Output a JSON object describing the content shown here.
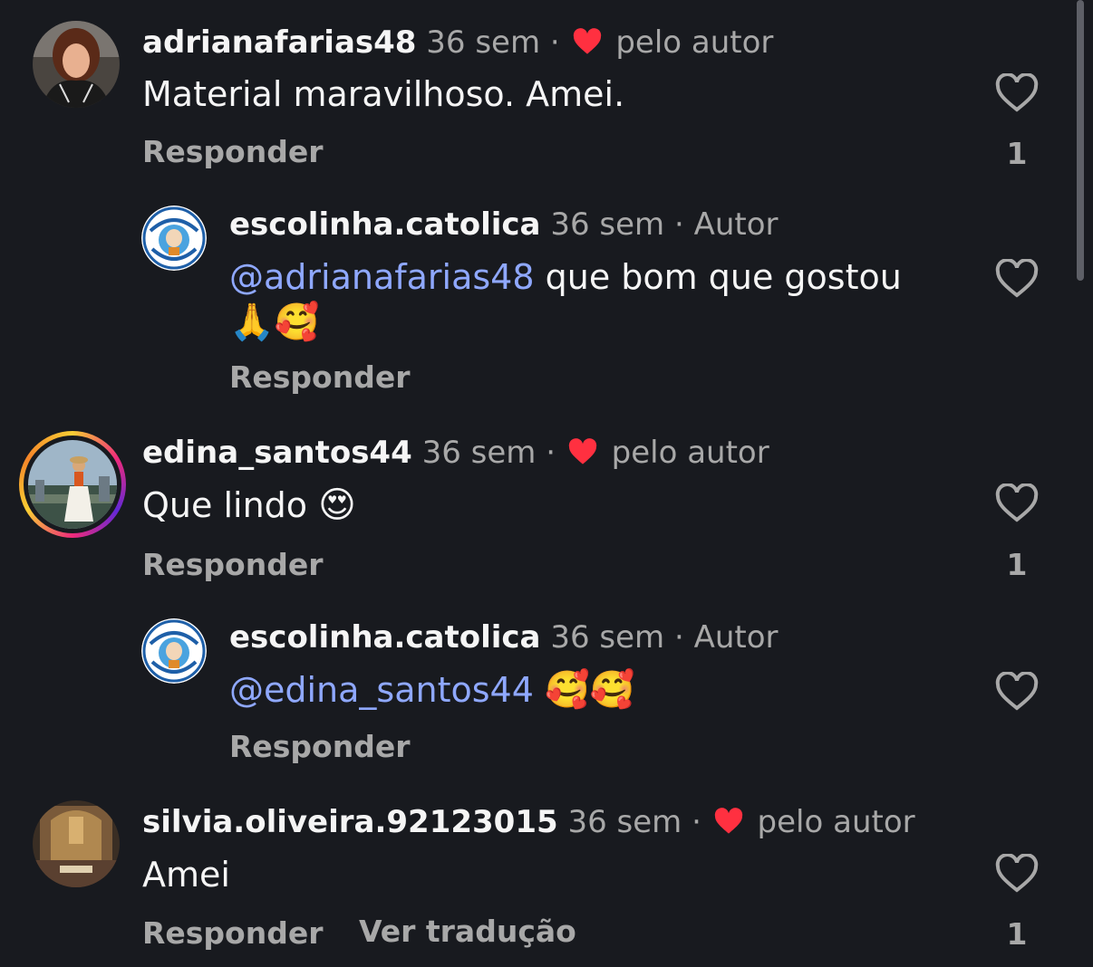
{
  "comments": [
    {
      "username": "adrianafarias48",
      "time": "36 sem",
      "separator": "·",
      "badge": "pelo autor",
      "text": "Material maravilhoso. Amei.",
      "reply_label": "Responder",
      "likes": "1"
    },
    {
      "username": "escolinha.catolica",
      "time": "36 sem",
      "separator": "·",
      "badge": "Autor",
      "mention": "@adrianafarias48",
      "text": " que bom que gostou",
      "emojis": "🙏🥰",
      "reply_label": "Responder"
    },
    {
      "username": "edina_santos44",
      "time": "36 sem",
      "separator": "·",
      "badge": "pelo autor",
      "text": "Que lindo ",
      "emojis": "😍",
      "reply_label": "Responder",
      "likes": "1"
    },
    {
      "username": "escolinha.catolica",
      "time": "36 sem",
      "separator": "·",
      "badge": "Autor",
      "mention": "@edina_santos44",
      "emojis": "🥰🥰",
      "reply_label": "Responder"
    },
    {
      "username": "silvia.oliveira.92123015",
      "time": "36 sem",
      "separator": "·",
      "badge": "pelo autor",
      "text": "Amei",
      "reply_label": "Responder",
      "translate_label": "Ver tradução",
      "likes": "1"
    }
  ],
  "icons": {
    "liked_by_author": "heart-filled-icon",
    "like": "heart-outline-icon"
  },
  "colors": {
    "background": "#181a1f",
    "mention": "#8fa8ff",
    "liked_heart": "#ff3040",
    "secondary_text": "#a8a8a8"
  }
}
